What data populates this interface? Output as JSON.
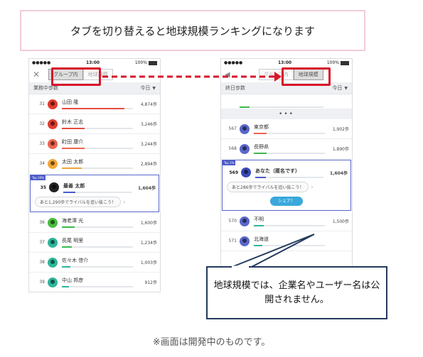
{
  "header_text": "タブを切り替えると地球規模ランキングになります",
  "footer_note": "※画面は開発中のものです。",
  "callout_text": "地球規模では、企業名やユーザー名は公開されません。",
  "colors": {
    "accent_red": "#d8162a",
    "brand_blue": "#4a5ac7",
    "share_blue": "#3aa8db",
    "navy": "#243a5e"
  },
  "left_phone": {
    "status": {
      "signal": "●●●●● ",
      "time": "13:00",
      "battery": "100%"
    },
    "close_icon": "✕",
    "tabs": [
      "グループ内",
      "地球規模"
    ],
    "subhead_label": "業務中歩数",
    "period_label": "今日",
    "rows": [
      {
        "rank": "31",
        "name": "山田 隆",
        "steps": "4,874歩",
        "fill": 0.88,
        "bar": "#e74c3c",
        "avatar": "#e13c2f"
      },
      {
        "rank": "32",
        "name": "鈴木 正志",
        "steps": "3,246歩",
        "fill": 0.32,
        "bar": "#e74c3c",
        "avatar": "#e13c2f"
      },
      {
        "rank": "33",
        "name": "町田 康介",
        "steps": "3,244歩",
        "fill": 0.32,
        "bar": "#f0644f",
        "avatar": "#ec6450"
      },
      {
        "rank": "34",
        "name": "太田 太郎",
        "steps": "2,894歩",
        "fill": 0.28,
        "bar": "#f0a53a",
        "avatar": "#f3a83a"
      }
    ],
    "highlight": {
      "badge": "Top 30%",
      "rank": "35",
      "name": "最善 太郎",
      "steps": "1,604歩",
      "fill": 0.18,
      "bar": "#4a5ac7",
      "challenge": "あと1,290歩でライバルを追い抜こう！"
    },
    "rows_after": [
      {
        "rank": "36",
        "name": "海老澤 光",
        "steps": "1,600歩",
        "fill": 0.18,
        "bar": "#3cb84a",
        "avatar": "#4cbb3f"
      },
      {
        "rank": "37",
        "name": "長尾 明里",
        "steps": "1,234歩",
        "fill": 0.14,
        "bar": "#3cb84a",
        "avatar": "#2fb59b"
      },
      {
        "rank": "38",
        "name": "佐々木 啓介",
        "steps": "1,003歩",
        "fill": 0.12,
        "bar": "#2fb59b",
        "avatar": "#2fb59b"
      },
      {
        "rank": "39",
        "name": "中山 邦彦",
        "steps": "912歩",
        "fill": 0.1,
        "bar": "#2fb59b",
        "avatar": "#2fb59b"
      }
    ]
  },
  "right_phone": {
    "status": {
      "signal": "●●●●● ",
      "time": "13:00",
      "battery": "100%"
    },
    "back_icon": "◀",
    "tabs": [
      "グループ内",
      "地球規模"
    ],
    "subhead_label": "終日歩数",
    "period_label": "今日",
    "ellipsis": "•••",
    "rows": [
      {
        "rank": "567",
        "name": "東京都",
        "steps": "1,902歩",
        "fill": 0.18,
        "bar": "#f0644f",
        "avatar": "#5a67c9"
      },
      {
        "rank": "568",
        "name": "長野県",
        "steps": "1,890歩",
        "fill": 0.18,
        "bar": "#3cb84a",
        "avatar": "#5a67c9"
      }
    ],
    "highlight": {
      "badge": "Top 1%",
      "rank": "569",
      "name": "あなた（匿名です）",
      "steps": "1,604歩",
      "fill": 0.16,
      "bar": "#4a5ac7",
      "challenge": "あと286歩でライバルを追い抜こう！",
      "share_label": "シェア！"
    },
    "rows_after": [
      {
        "rank": "570",
        "name": "不明",
        "steps": "1,500歩",
        "fill": 0.14,
        "bar": "#2fb59b",
        "avatar": "#5a67c9"
      },
      {
        "rank": "571",
        "name": "北海道",
        "steps": "",
        "fill": 0.12,
        "bar": "#2fb59b",
        "avatar": "#5a67c9"
      }
    ]
  }
}
